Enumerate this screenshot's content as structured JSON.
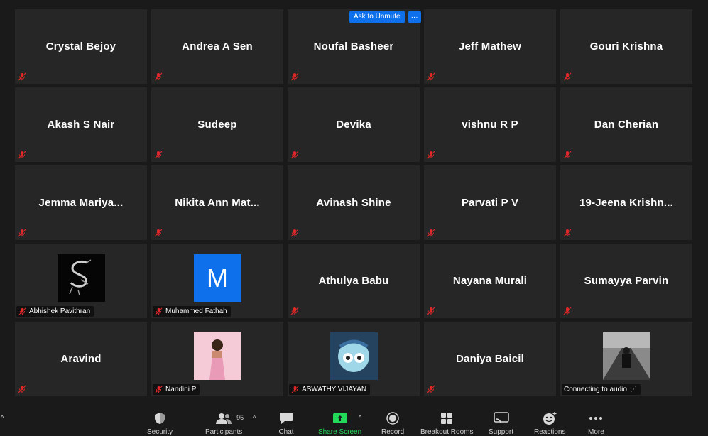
{
  "meeting": {
    "ask_to_unmute_label": "Ask to Unmute",
    "more_options_label": "···",
    "tiles": [
      {
        "name": "Crystal Bejoy"
      },
      {
        "name": "Andrea A Sen"
      },
      {
        "name": "Noufal Basheer"
      },
      {
        "name": "Jeff Mathew"
      },
      {
        "name": "Gouri Krishna"
      },
      {
        "name": "Akash S Nair"
      },
      {
        "name": "Sudeep"
      },
      {
        "name": "Devika"
      },
      {
        "name": "vishnu R P"
      },
      {
        "name": "Dan Cherian"
      },
      {
        "name": "Jemma  Mariya..."
      },
      {
        "name": "Nikita  Ann  Mat..."
      },
      {
        "name": "Avinash Shine"
      },
      {
        "name": "Parvati P V"
      },
      {
        "name": "19-Jeena  Krishn..."
      },
      {
        "label": "Abhishek Pavithran",
        "avatar": "dragon-image"
      },
      {
        "label": "Muhammed Fathah",
        "avatar_letter": "M"
      },
      {
        "name": "Athulya Babu"
      },
      {
        "name": "Nayana Murali"
      },
      {
        "name": "Sumayya Parvin"
      },
      {
        "name": "Aravind"
      },
      {
        "label": "Nandini P",
        "avatar": "person-photo"
      },
      {
        "label": "ASWATHY VIJAYAN",
        "avatar": "cartoon-avatar"
      },
      {
        "name": "Daniya Baicil"
      },
      {
        "label": "Connecting to audio",
        "avatar": "motorcycle-photo"
      }
    ]
  },
  "toolbar": {
    "security": "Security",
    "participants": "Participants",
    "participants_count": "95",
    "chat": "Chat",
    "share_screen": "Share Screen",
    "record": "Record",
    "breakout_rooms": "Breakout Rooms",
    "support": "Support",
    "reactions": "Reactions",
    "more": "More"
  },
  "colors": {
    "background": "#1a1a1a",
    "tile": "#262626",
    "accent_blue": "#0e71eb",
    "muted_red": "#e02828",
    "share_green": "#23d959"
  }
}
